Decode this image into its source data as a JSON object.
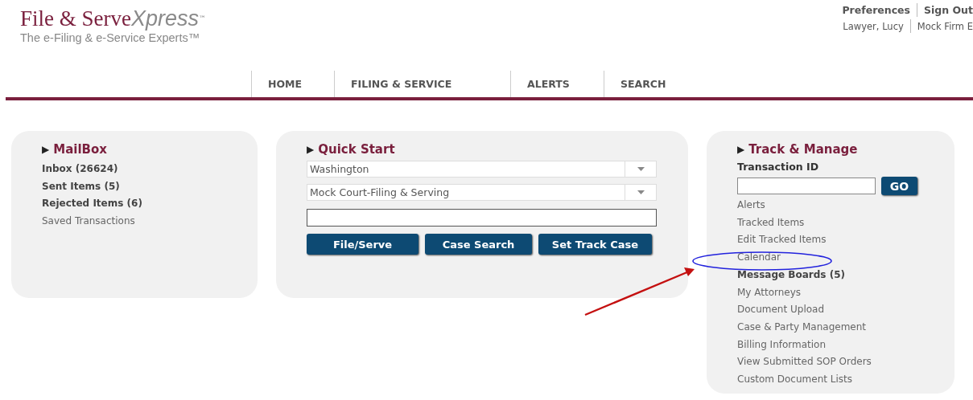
{
  "logo": {
    "primary": "File & Serve",
    "accent": "Xpress",
    "mark": "™",
    "tagline": "The e-Filing & e-Service Experts™"
  },
  "account": {
    "links": [
      "Preferences",
      "Sign Out"
    ],
    "user": "Lawyer, Lucy",
    "firm": "Mock Firm E"
  },
  "nav": [
    "HOME",
    "FILING & SERVICE",
    "ALERTS",
    "SEARCH"
  ],
  "mailbox": {
    "marker": "▶",
    "title": "MailBox",
    "items": [
      {
        "label": "Inbox (26624)",
        "bold": true
      },
      {
        "label": "Sent Items (5)",
        "bold": true
      },
      {
        "label": "Rejected Items (6)",
        "bold": true
      },
      {
        "label": "Saved Transactions",
        "bold": false
      }
    ]
  },
  "quick_start": {
    "marker": "▶",
    "title": "Quick Start",
    "dropdowns": [
      "Washington",
      "Mock Court-Filing & Serving"
    ],
    "buttons": [
      "File/Serve",
      "Case Search",
      "Set Track Case"
    ]
  },
  "track_manage": {
    "marker": "▶",
    "title": "Track & Manage",
    "field_label": "Transaction ID",
    "go_button": "GO",
    "items": [
      {
        "label": "Alerts",
        "bold": false
      },
      {
        "label": "Tracked Items",
        "bold": false
      },
      {
        "label": "Edit Tracked Items",
        "bold": false
      },
      {
        "label": "Calendar",
        "bold": false
      },
      {
        "label": "Message Boards (5)",
        "bold": true
      },
      {
        "label": "My Attorneys",
        "bold": false
      },
      {
        "label": "Document Upload",
        "bold": false
      },
      {
        "label": "Case & Party Management",
        "bold": false
      },
      {
        "label": "Billing Information",
        "bold": false
      },
      {
        "label": "View Submitted SOP Orders",
        "bold": false
      },
      {
        "label": "Custom Document Lists",
        "bold": false
      }
    ]
  }
}
